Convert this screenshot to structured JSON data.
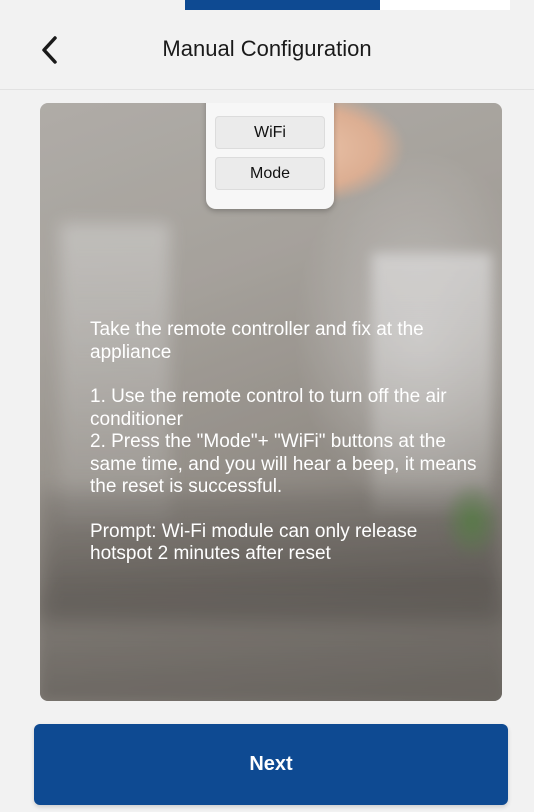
{
  "header": {
    "title": "Manual Configuration",
    "back_icon": "chevron-left-icon"
  },
  "remote": {
    "wifi_label": "WiFi",
    "mode_label": "Mode"
  },
  "instructions": {
    "intro": "Take the remote controller and fix at the appliance",
    "step1": "1. Use the remote control to turn off the air conditioner",
    "step2": "2. Press the \"Mode\"+ \"WiFi\" buttons at the same time, and you will hear a beep, it means the reset is successful.",
    "prompt": "Prompt: Wi-Fi module can only release hotspot 2 minutes after reset"
  },
  "footer": {
    "next_label": "Next"
  },
  "colors": {
    "brand": "#0e4a92",
    "background": "#f2f2f2",
    "text_on_image": "#ffffff"
  }
}
